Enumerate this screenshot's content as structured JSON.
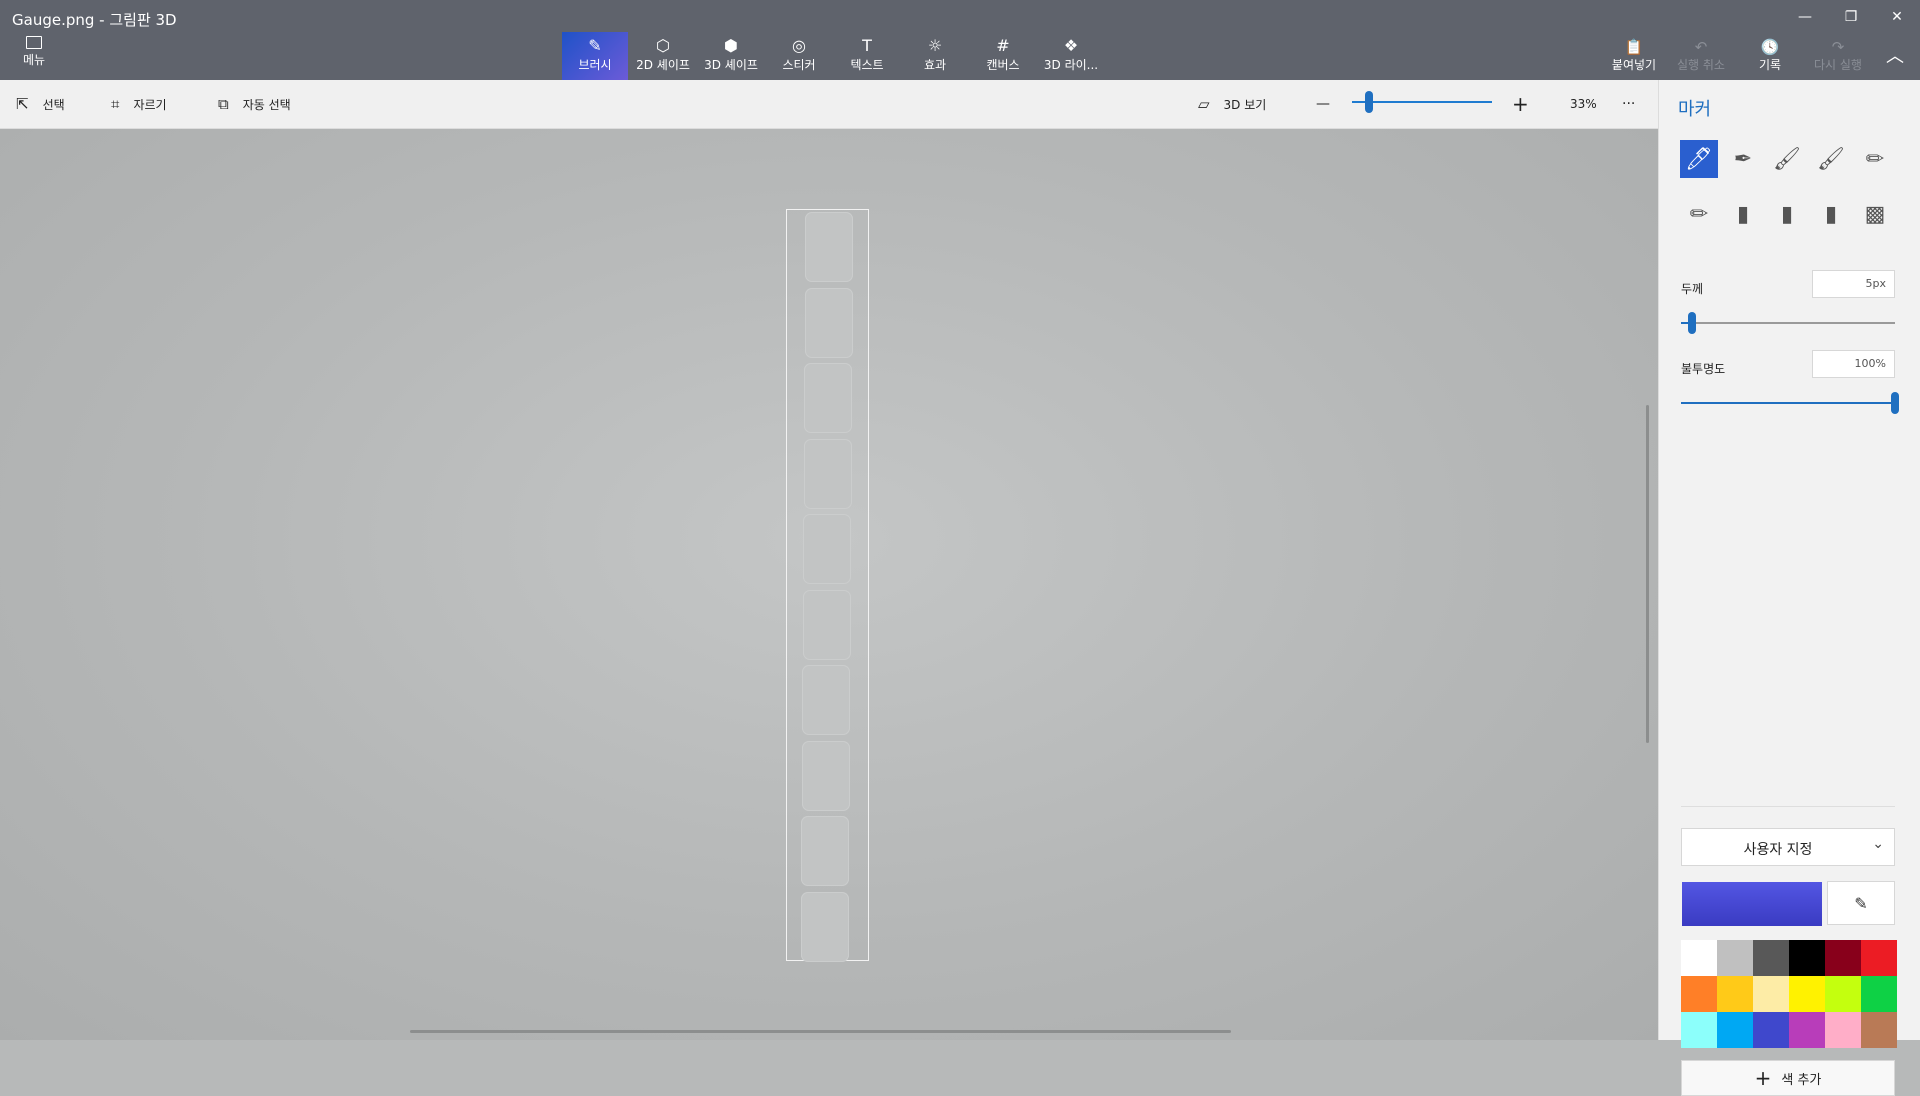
{
  "window": {
    "title": "Gauge.png - 그림판 3D",
    "minimize": "—",
    "restore": "❐",
    "close": "✕"
  },
  "ribbon": {
    "menu": "메뉴",
    "tabs": [
      {
        "label": "브러시",
        "glyph": "✎"
      },
      {
        "label": "2D 셰이프",
        "glyph": "⬡"
      },
      {
        "label": "3D 셰이프",
        "glyph": "⬢"
      },
      {
        "label": "스티커",
        "glyph": "◎"
      },
      {
        "label": "텍스트",
        "glyph": "T"
      },
      {
        "label": "효과",
        "glyph": "☼"
      },
      {
        "label": "캔버스",
        "glyph": "#"
      },
      {
        "label": "3D 라이...",
        "glyph": "❖"
      }
    ],
    "active_tab": "브러시",
    "paste": "붙여넣기",
    "undo": "실행 취소",
    "history": "기록",
    "redo": "다시 실행",
    "collapse": "︿"
  },
  "toolbar": {
    "select": "선택",
    "crop": "자르기",
    "magic_select": "자동 선택",
    "view_3d": "3D 보기",
    "zoom_out": "—",
    "zoom_in": "+",
    "zoom_level": "33%",
    "more": "···",
    "zoom_fraction": 0.12
  },
  "canvas": {
    "gauge_cells": 10,
    "bg_color": "#b7b9b9"
  },
  "panel": {
    "title": "마커",
    "brushes": [
      {
        "name": "marker-icon",
        "glyph": "🖊",
        "active": true
      },
      {
        "name": "calligraphy-pen-icon",
        "glyph": "✒"
      },
      {
        "name": "oil-brush-icon",
        "glyph": "🖌"
      },
      {
        "name": "watercolor-icon",
        "glyph": "🖌"
      },
      {
        "name": "pixel-pen-icon",
        "glyph": "✏"
      },
      {
        "name": "pencil-icon",
        "glyph": "✏"
      },
      {
        "name": "eraser-icon",
        "glyph": "▮"
      },
      {
        "name": "crayon-icon",
        "glyph": "▮"
      },
      {
        "name": "spray-can-icon",
        "glyph": "▮"
      },
      {
        "name": "fill-bucket-icon",
        "glyph": "▩"
      }
    ],
    "thickness_label": "두께",
    "thickness_value": "5px",
    "thickness_fraction": 0.05,
    "opacity_label": "불투명도",
    "opacity_value": "100%",
    "opacity_fraction": 1.0,
    "color_mode": "사용자 지정",
    "add_color": "색 추가",
    "accent": "#1f6fc0",
    "current_color": "#3a3bc2",
    "palette": [
      "#ffffff",
      "#c0c0c0",
      "#585858",
      "#000000",
      "#88001b",
      "#ec1c24",
      "#ff7f27",
      "#ffca18",
      "#fdeca6",
      "#fff200",
      "#c4ff0e",
      "#0ed145",
      "#8cfffb",
      "#00a8f3",
      "#3f48cc",
      "#b83dba",
      "#ffaec8",
      "#b97a56"
    ]
  }
}
